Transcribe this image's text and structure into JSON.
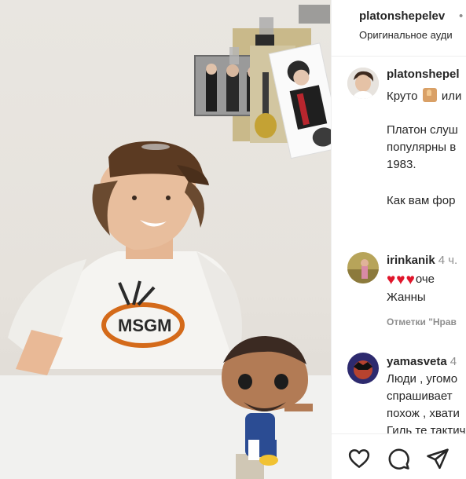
{
  "header": {
    "username": "platonshepelev",
    "separator": "•",
    "audio": "Оригинальное ауди"
  },
  "caption": {
    "username": "platonshepel",
    "line1_start": "Круто",
    "line1_end": "или",
    "para1": [
      "Платон слуш",
      "популярны в",
      "1983."
    ],
    "para2": "Как вам фор"
  },
  "comments": [
    {
      "username": "irinkanik",
      "time": "4 ч.",
      "text_inline": "оче",
      "text_lines": [
        "Жанны"
      ],
      "meta": "Отметки \"Нрав",
      "hearts": 3
    },
    {
      "username": "yamasveta",
      "time": "4",
      "text_lines": [
        "Люди , угомо",
        "спрашивает",
        "похож , хвати",
        "Гиль те тактич"
      ]
    }
  ],
  "icons": {
    "like": "heart-outline-icon",
    "comment": "comment-bubble-icon",
    "share": "paper-plane-icon"
  },
  "colors": {
    "username": "#262626",
    "muted": "#8e8e8e",
    "heart": "#e0162b",
    "divider": "#efefef"
  }
}
